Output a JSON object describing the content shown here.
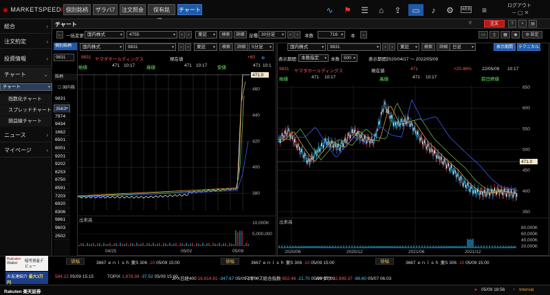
{
  "app": {
    "logo_text": "MARKETSPEED",
    "logo_suffix": "II",
    "logout": "ログアウト",
    "web": "WEB"
  },
  "top_tabs": [
    "個別銘柄",
    "ザラバ7",
    "注文照会",
    "保有銘柄...",
    "チャート"
  ],
  "top_icons": [
    "pulse-icon",
    "alert-flag-icon",
    "news-icon",
    "home-icon",
    "upload-icon",
    "card-icon",
    "bell-icon",
    "settings-icon",
    "web-icon",
    "menu-icon"
  ],
  "sidebar": {
    "items": [
      {
        "label": "総合"
      },
      {
        "label": "注文約定"
      },
      {
        "label": "投資情報"
      },
      {
        "label": "チャート"
      },
      {
        "label": "ニュース"
      },
      {
        "label": "マイページ"
      }
    ],
    "sub": [
      "チャート",
      "指数化チャート",
      "スプレッドチャート",
      "損益線チャート"
    ]
  },
  "header": {
    "title": "チャート",
    "order": "注文",
    "settings": "設定"
  },
  "toolbar": {
    "bulk": "一括変更",
    "market": "国内株式",
    "code": "4755",
    "exchange": "東証",
    "search": "検索",
    "detail": "詳細",
    "period_label": "足種",
    "period": "30分足",
    "count_label": "本数",
    "count": "716",
    "count_unit": "本"
  },
  "left_chart": {
    "tab": "個別銘柄",
    "market": "国内株式",
    "code": "9831",
    "exchange": "東証",
    "period": "5分足",
    "code_line": "9831",
    "name": "ヤマダホールディングス",
    "now_label": "現在値",
    "now_value": "471",
    "change": "+80",
    "row2": {
      "open_label": "始値",
      "open_value": "471",
      "open_time": "10:17",
      "high_label": "高値",
      "high_value": "471",
      "high_time": "10:17",
      "low_label": "安値",
      "low_value": "471",
      "low_time": "10:1"
    },
    "price_tag": "471.0",
    "y_ticks": [
      "460",
      "440",
      "420",
      "400",
      "380"
    ],
    "volume_label": "出来高",
    "volume_ticks": [
      "10,000K",
      "5,000,000"
    ],
    "x_ticks": [
      "04/25",
      "05/02",
      "05/09"
    ]
  },
  "right_chart": {
    "market": "国内株式",
    "code": "9831",
    "exchange": "東証",
    "search": "検索",
    "detail": "詳細",
    "display_label": "表示期間",
    "display_mode": "本数指定",
    "count_label": "本数",
    "count": "500",
    "period_label": "表示期間：",
    "period_range": "2020/04/17 〜 2022/05/09",
    "freq": "日足",
    "btn_display": "表示期間",
    "btn_tech": "テクニカル",
    "code_line": "9831",
    "name": "ヤマダホールディングス",
    "now_label": "現在値",
    "now_value": "471",
    "change": "+20.46%",
    "date": "22/05/09",
    "time": "10:17",
    "row2": {
      "open_label": "始値",
      "open_value": "471",
      "open_time": "10:17",
      "high_label": "高値",
      "high_value": "471",
      "high_time": "10:17",
      "prev_label": "前日終値"
    },
    "price_tag": "471.0",
    "y_ticks": [
      "650",
      "600",
      "550",
      "500",
      "450",
      "400",
      "350"
    ],
    "volume_label": "出来高",
    "volume_ticks": [
      "80,000K",
      "60,000K",
      "40,000K",
      "20,000K"
    ],
    "x_ticks": [
      "2020/06",
      "2020/12",
      "2021/06",
      "2021/12"
    ]
  },
  "watchlist": {
    "codes": [
      "9831",
      "3563",
      "7974",
      "9434",
      "1662",
      "6501",
      "8001",
      "9201",
      "9202",
      "8253",
      "8750",
      "8591",
      "7203",
      "6920",
      "8306",
      "9861",
      "9603",
      "2502"
    ],
    "header": "国内株",
    "title": "銘柄"
  },
  "ticker": {
    "items": [
      {
        "tag": "値幅",
        "code": "3667",
        "name": "ｅｎｉｓｈ",
        "mkt": "東S",
        "price": "306",
        "chg": "-10",
        "date": "05/09",
        "time": "15:00"
      },
      {
        "tag": "値幅",
        "code": "3667",
        "name": "ｅｎｉｓｈ",
        "mkt": "東S",
        "price": "306",
        "chg": "-10",
        "date": "05/09",
        "time": "15:00"
      },
      {
        "tag": "値幅",
        "code": "3667",
        "name": "ｅｎｉｓｈ",
        "mkt": "東S",
        "price": "306",
        "chg": "-10",
        "date": "05/09",
        "time": "15:00"
      }
    ]
  },
  "indices": [
    {
      "name": "",
      "value": "584.22",
      "chg": "",
      "date": "05/09",
      "time": "15:15"
    },
    {
      "name": "TOPIX",
      "value": "1,878.39",
      "chg": "-37.52",
      "date": "05/09",
      "time": "15:00"
    },
    {
      "name": "JPX日経400",
      "value": "16,914.91",
      "chg": "-347.67",
      "date": "05/09",
      "time": "15:00"
    },
    {
      "name": "マザーズ総合指数",
      "value": "652.48",
      "chg": "-21.70",
      "date": "05/09",
      "time": "15:00"
    },
    {
      "name": "NYダウ",
      "value": "32,899.37",
      "chg": "-98.60",
      "date": "05/07",
      "time": "06:03"
    }
  ],
  "ads": {
    "wallet_brand": "Rakuten",
    "wallet": "Wallet",
    "wallet_text": "暗号資産デビュー",
    "friend_text": "お友達紹介",
    "prize": "最大3万円"
  },
  "status": {
    "brand": "Rakuten",
    "brand_sub": "楽天証券",
    "datetime": "05/09 18:56",
    "interval": "Interval"
  },
  "colors": {
    "up": "#ff3b3b",
    "down": "#2ec4ff",
    "accent": "#1e5aa8",
    "ma1": "#e6a23c",
    "ma2": "#6ab04c",
    "ma3": "#3c5cff"
  }
}
